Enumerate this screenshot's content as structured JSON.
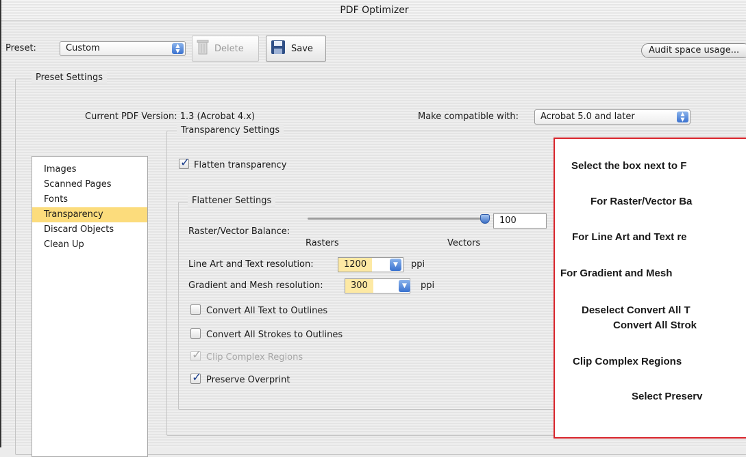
{
  "window": {
    "title": "PDF Optimizer"
  },
  "toolbar": {
    "preset_label": "Preset:",
    "preset_value": "Custom",
    "delete_label": "Delete",
    "save_label": "Save",
    "audit_label": "Audit space usage..."
  },
  "preset_settings": {
    "title": "Preset Settings",
    "current_version": "Current PDF Version: 1.3 (Acrobat 4.x)",
    "compat_label": "Make compatible with:",
    "compat_value": "Acrobat 5.0 and later"
  },
  "sidebar": {
    "items": [
      {
        "label": "Images",
        "selected": false
      },
      {
        "label": "Scanned Pages",
        "selected": false
      },
      {
        "label": "Fonts",
        "selected": false
      },
      {
        "label": "Transparency",
        "selected": true
      },
      {
        "label": "Discard Objects",
        "selected": false
      },
      {
        "label": "Clean Up",
        "selected": false
      }
    ]
  },
  "transparency": {
    "group_title": "Transparency Settings",
    "flatten_label": "Flatten transparency",
    "flatten_checked": true,
    "flattener": {
      "group_title": "Flattener Settings",
      "balance_label": "Raster/Vector Balance:",
      "balance_min_label": "Rasters",
      "balance_max_label": "Vectors",
      "balance_value": "100",
      "balance_fraction": 1.0,
      "lineart_label": "Line Art and Text resolution:",
      "lineart_value": "1200",
      "lineart_unit": "ppi",
      "gradient_label": "Gradient and Mesh resolution:",
      "gradient_value": "300",
      "gradient_unit": "ppi",
      "convert_text_label": "Convert All Text to Outlines",
      "convert_text_checked": false,
      "convert_strokes_label": "Convert All Strokes to Outlines",
      "convert_strokes_checked": false,
      "clip_label": "Clip Complex Regions",
      "clip_checked": true,
      "clip_enabled": false,
      "overprint_label": "Preserve Overprint",
      "overprint_checked": true
    }
  },
  "instructions": {
    "lines": [
      "Select the box next to F",
      "For Raster/Vector Ba",
      "For Line Art and Text re",
      "For Gradient and Mesh",
      "Deselect Convert All T",
      "Convert All Strok",
      "Clip Complex Regions",
      "Select Preserv"
    ],
    "border_color": "#d8232a"
  },
  "colors": {
    "selection": "#fcdc7c",
    "field_highlight": "#fde9a4",
    "accent_blue": "#3a72cf"
  }
}
